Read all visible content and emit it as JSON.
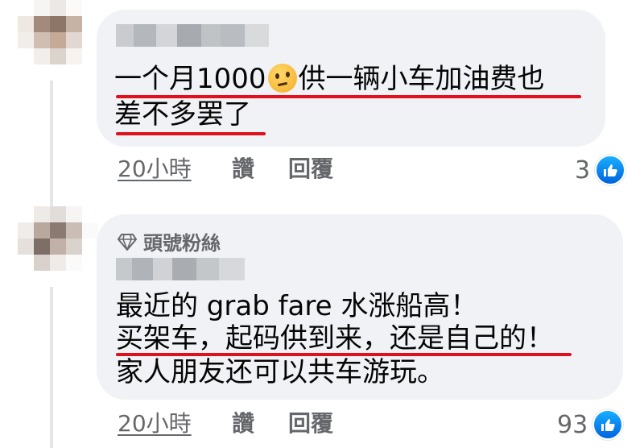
{
  "comments": [
    {
      "lines": [
        "一个月1000",
        "供一辆小车加油费也",
        "差不多罢了"
      ],
      "time": "20小時",
      "like_label": "讚",
      "reply_label": "回覆",
      "reaction_count": "3",
      "emoji": "thinking-face-icon"
    },
    {
      "badge": "頭號粉絲",
      "lines": [
        "最近的 grab fare 水涨船高！",
        "买架车，起码供到来，还是自己的！",
        "家人朋友还可以共车游玩。"
      ],
      "time": "20小時",
      "like_label": "讚",
      "reply_label": "回覆",
      "reaction_count": "93"
    }
  ],
  "colors": {
    "bubble": "#f0f2f5",
    "underline": "#e0101c",
    "meta_text": "#65676b",
    "like_blue": "#1877f2"
  }
}
